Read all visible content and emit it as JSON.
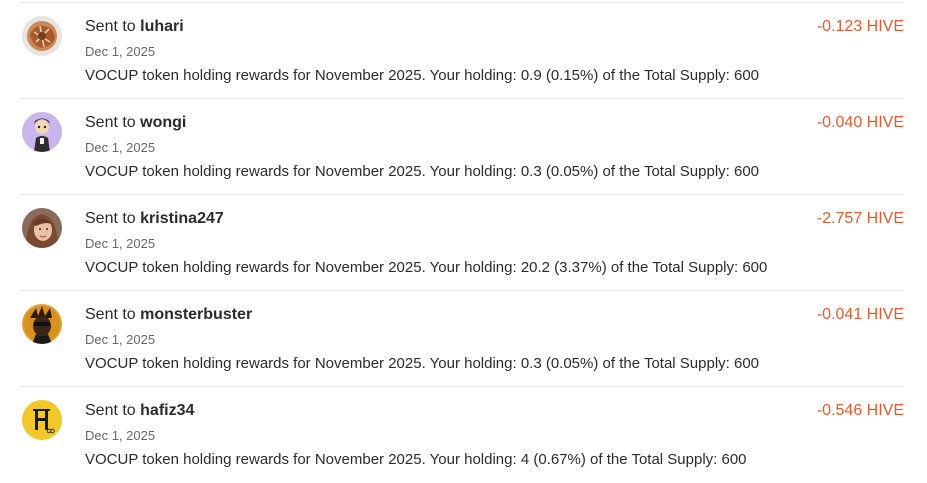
{
  "colors": {
    "amount": "#e25b2c",
    "divider": "#e3e3e3",
    "date": "#666666",
    "text": "#2b2b2b"
  },
  "transactions": [
    {
      "prefix": "Sent to",
      "username": "luhari",
      "date": "Dec 1, 2025",
      "memo": "VOCUP token holding rewards for November 2025. Your holding: 0.9 (0.15%) of the Total Supply: 600",
      "amount": "-0.123 HIVE",
      "avatar_icon": "user-avatar-luhari-icon"
    },
    {
      "prefix": "Sent to",
      "username": "wongi",
      "date": "Dec 1, 2025",
      "memo": "VOCUP token holding rewards for November 2025. Your holding: 0.3 (0.05%) of the Total Supply: 600",
      "amount": "-0.040 HIVE",
      "avatar_icon": "user-avatar-wongi-icon"
    },
    {
      "prefix": "Sent to",
      "username": "kristina247",
      "date": "Dec 1, 2025",
      "memo": "VOCUP token holding rewards for November 2025. Your holding: 20.2 (3.37%) of the Total Supply: 600",
      "amount": "-2.757 HIVE",
      "avatar_icon": "user-avatar-kristina247-icon"
    },
    {
      "prefix": "Sent to",
      "username": "monsterbuster",
      "date": "Dec 1, 2025",
      "memo": "VOCUP token holding rewards for November 2025. Your holding: 0.3 (0.05%) of the Total Supply: 600",
      "amount": "-0.041 HIVE",
      "avatar_icon": "user-avatar-monsterbuster-icon"
    },
    {
      "prefix": "Sent to",
      "username": "hafiz34",
      "date": "Dec 1, 2025",
      "memo": "VOCUP token holding rewards for November 2025. Your holding: 4 (0.67%) of the Total Supply: 600",
      "amount": "-0.546 HIVE",
      "avatar_icon": "user-avatar-hafiz34-icon"
    }
  ]
}
